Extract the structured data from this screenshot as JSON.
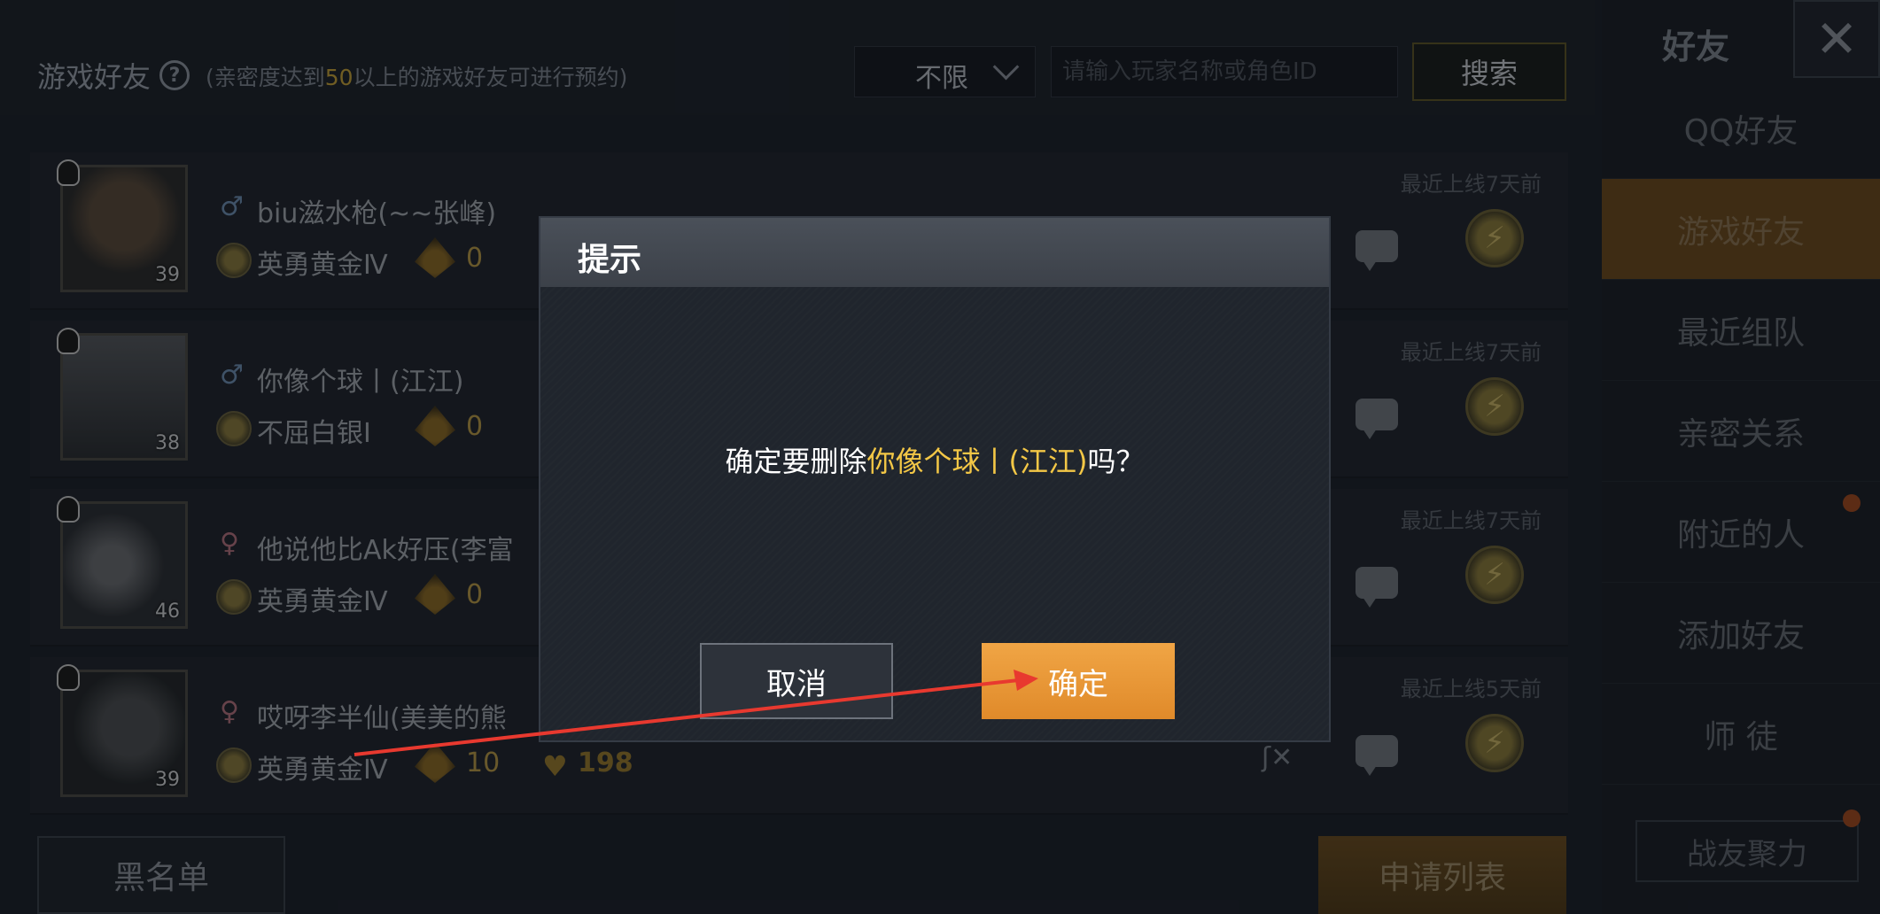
{
  "header": {
    "title": "游戏好友",
    "hint_prefix": "(亲密度达到",
    "hint_highlight": "50",
    "hint_suffix": "以上的游戏好友可进行预约)",
    "filter_value": "不限",
    "search_placeholder": "请输入玩家名称或角色ID",
    "search_button": "搜索"
  },
  "friends": [
    {
      "name": "biu滋水枪(~~张峰)",
      "gender": "♂",
      "rank": "英勇黄金Ⅳ",
      "intimacy": "0",
      "level": "39",
      "last_online": "最近上线7天前"
    },
    {
      "name": "你像个球丨(江江)",
      "gender": "♂",
      "rank": "不屈白银Ⅰ",
      "intimacy": "0",
      "level": "38",
      "last_online": "最近上线7天前"
    },
    {
      "name": "他说他比Ak好压(李富",
      "gender": "♀",
      "rank": "英勇黄金Ⅳ",
      "intimacy": "0",
      "level": "46",
      "last_online": "最近上线7天前"
    },
    {
      "name": "哎呀李半仙(美美的熊",
      "gender": "♀",
      "rank": "英勇黄金Ⅳ",
      "intimacy": "10",
      "heart": "198",
      "level": "39",
      "last_online": "最近上线5天前"
    }
  ],
  "bottom": {
    "blacklist": "黑名单",
    "apply_list": "申请列表"
  },
  "sidebar": {
    "title": "好友",
    "close": "✕",
    "items": [
      "QQ好友",
      "游戏好友",
      "最近组队",
      "亲密关系",
      "附近的人",
      "添加好友",
      "师 徒"
    ],
    "active_index": 1,
    "last": "战友聚力"
  },
  "dialog": {
    "title": "提示",
    "msg_prefix": "确定要删除",
    "msg_name": "你像个球丨(江江)",
    "msg_suffix": "吗？",
    "cancel": "取消",
    "confirm": "确定"
  },
  "colors": {
    "highlight": "#f3c746",
    "confirm": "#e99a38",
    "arrow": "#e8392f"
  }
}
